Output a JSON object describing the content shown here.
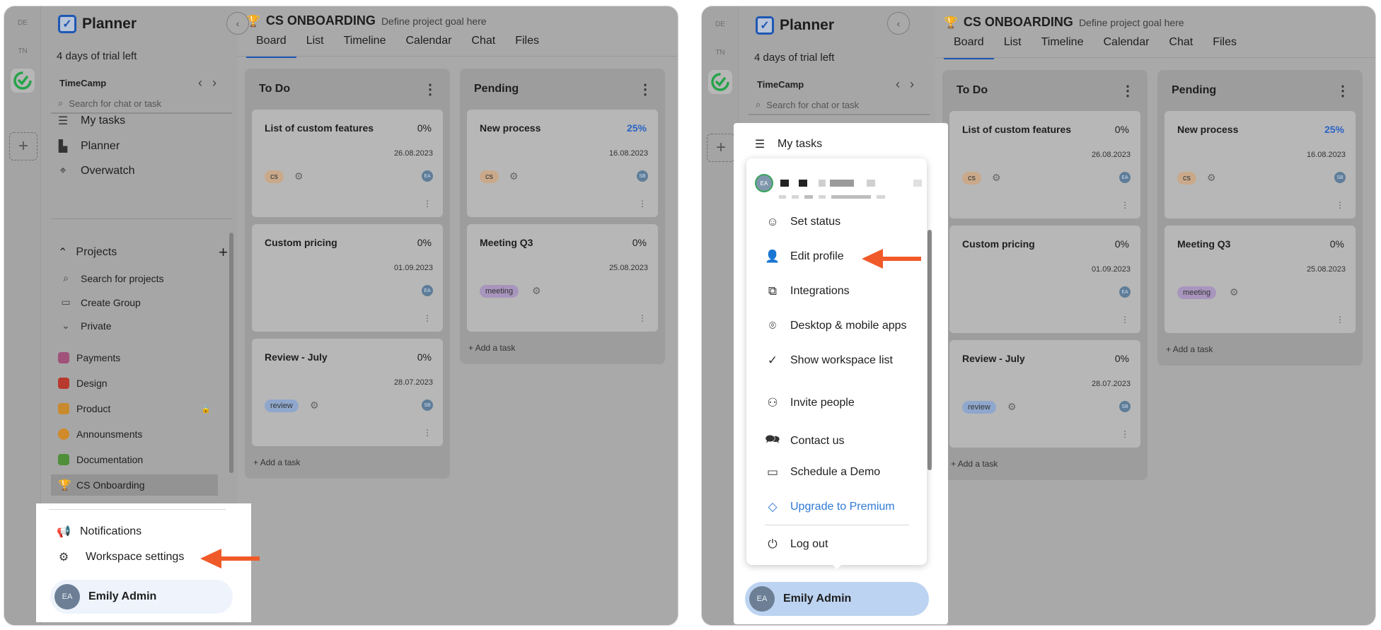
{
  "app": {
    "name": "Planner",
    "trial": "4 days of trial left",
    "workspace": "TimeCamp"
  },
  "rail": {
    "items": [
      "DE",
      "TN"
    ]
  },
  "search": {
    "placeholder": "Search for chat or task"
  },
  "nav": [
    {
      "label": "My tasks",
      "icon": "checklist-icon"
    },
    {
      "label": "Planner",
      "icon": "planner-chart-icon"
    },
    {
      "label": "Overwatch",
      "icon": "telescope-icon"
    }
  ],
  "projects": {
    "heading": "Projects",
    "search": "Search for projects",
    "create_group": "Create Group",
    "private": "Private",
    "items": [
      {
        "label": "Payments",
        "color": "#a0527a"
      },
      {
        "label": "Design",
        "color": "#b83a2e"
      },
      {
        "label": "Product",
        "color": "#c98a2e"
      },
      {
        "label": "Announsments",
        "color": "#d08a2a"
      },
      {
        "label": "Documentation",
        "color": "#4f8f3a"
      },
      {
        "label": "CS Onboarding",
        "color": "#1e57b3"
      }
    ]
  },
  "project": {
    "title": "CS ONBOARDING",
    "subtitle": "Define project goal here"
  },
  "tabs": [
    "Board",
    "List",
    "Timeline",
    "Calendar",
    "Chat",
    "Files"
  ],
  "board": {
    "add_task": "Add a task",
    "columns": [
      {
        "title": "To Do",
        "cards": [
          {
            "title": "List of custom features",
            "pct": "0%",
            "date": "26.08.2023",
            "tag": "cs",
            "avatar": "EA"
          },
          {
            "title": "Custom pricing",
            "pct": "0%",
            "date": "01.09.2023",
            "tag": "",
            "avatar": "EA"
          },
          {
            "title": "Review - July",
            "pct": "0%",
            "date": "28.07.2023",
            "tag": "review",
            "avatar": "SB"
          }
        ]
      },
      {
        "title": "Pending",
        "cards": [
          {
            "title": "New process",
            "pct": "25%",
            "date": "16.08.2023",
            "tag": "cs",
            "avatar": "SB"
          },
          {
            "title": "Meeting Q3",
            "pct": "0%",
            "date": "25.08.2023",
            "tag": "meeting",
            "avatar": ""
          }
        ]
      }
    ]
  },
  "popup_left": {
    "notifications": "Notifications",
    "workspace_settings": "Workspace settings"
  },
  "user": {
    "name": "Emily Admin",
    "initials": "EA"
  },
  "profile_menu": {
    "items": [
      {
        "label": "Set status",
        "icon": "smiley-icon"
      },
      {
        "label": "Edit profile",
        "icon": "user-gear-icon"
      },
      {
        "label": "Integrations",
        "icon": "puzzle-icon"
      },
      {
        "label": "Desktop & mobile apps",
        "icon": "location-pin-icon"
      },
      {
        "label": "Show workspace list",
        "icon": "check-icon"
      },
      {
        "label": "Invite people",
        "icon": "user-plus-icon"
      },
      {
        "label": "Contact us",
        "icon": "chat-bubbles-icon"
      },
      {
        "label": "Schedule a Demo",
        "icon": "presentation-icon"
      },
      {
        "label": "Upgrade to Premium",
        "icon": "diamond-icon"
      },
      {
        "label": "Log out",
        "icon": "power-icon"
      }
    ]
  },
  "colors": {
    "accent": "#1e57b3",
    "arrow": "#f05a28",
    "upgrade": "#2f7ad6"
  }
}
